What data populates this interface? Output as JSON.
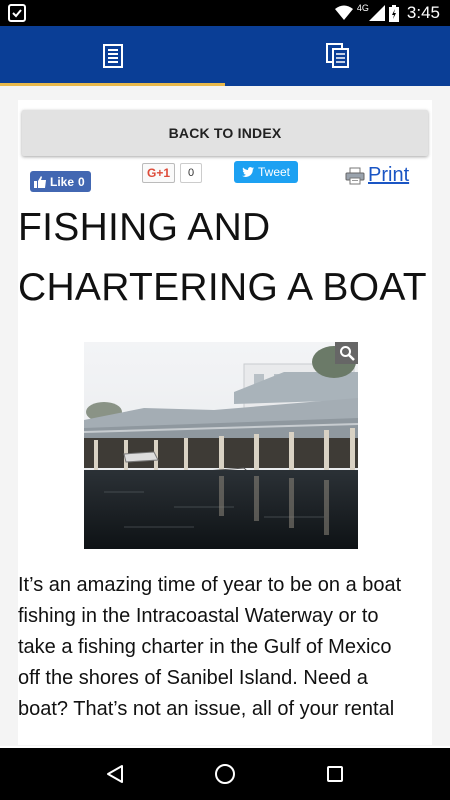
{
  "status_bar": {
    "network": "4G",
    "time": "3:45",
    "icons": [
      "notification-icon",
      "wifi-icon",
      "signal-icon",
      "battery-icon"
    ]
  },
  "tabs": [
    {
      "icon": "article-icon",
      "active": true
    },
    {
      "icon": "pages-icon",
      "active": false
    }
  ],
  "back_button": {
    "label": "BACK TO INDEX"
  },
  "share": {
    "facebook": {
      "label": "Like",
      "count": "0"
    },
    "gplus": {
      "label": "G+1",
      "count": "0"
    },
    "twitter": {
      "label": "Tweet"
    },
    "print": {
      "label": "Print"
    }
  },
  "article": {
    "title_line1": "FISHING AND",
    "title_line2": "CHARTERING A BOAT",
    "image_alt": "boat-dock-photo",
    "body_lines": [
      "It’s an amazing time of year to be on a boat",
      "fishing in the Intracoastal Waterway or to",
      "take a fishing charter in the Gulf of Mexico",
      "off the shores of Sanibel Island. Need a",
      "boat? That’s not an issue, all of your rental"
    ]
  },
  "colors": {
    "header": "#0a3e96",
    "tab_indicator": "#e8b84a",
    "link": "#1a55c4",
    "facebook": "#4267b2",
    "twitter": "#1da1f2"
  }
}
